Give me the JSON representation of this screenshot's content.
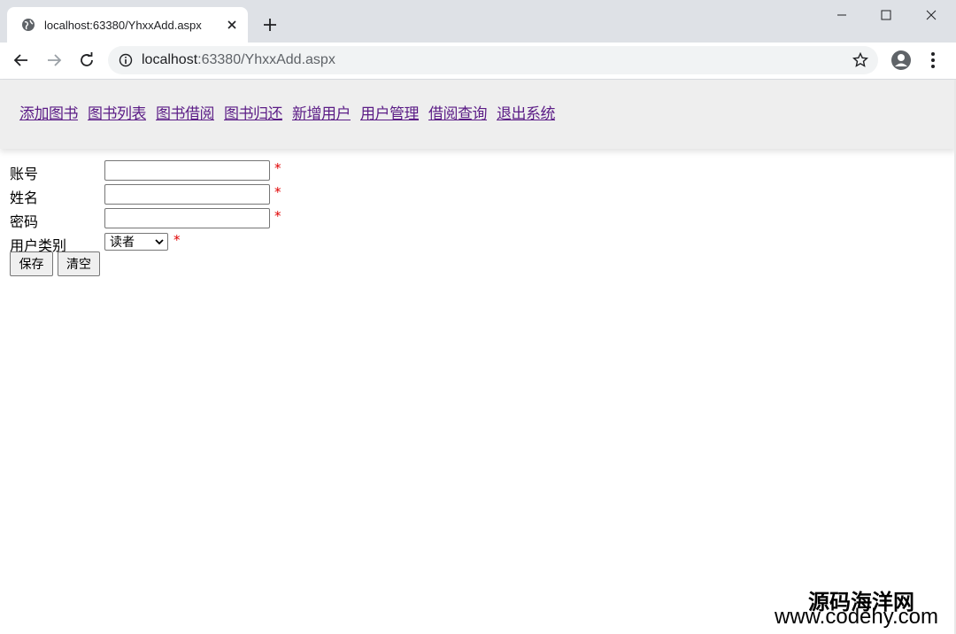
{
  "browser": {
    "tab_title": "localhost:63380/YhxxAdd.aspx",
    "url_host": "localhost",
    "url_rest": ":63380/YhxxAdd.aspx"
  },
  "nav": {
    "links": [
      "添加图书",
      "图书列表",
      "图书借阅",
      "图书归还",
      "新增用户",
      "用户管理",
      "借阅查询",
      "退出系统"
    ]
  },
  "form": {
    "account_label": "账号",
    "name_label": "姓名",
    "password_label": "密码",
    "user_type_label": "用户类别",
    "user_type_value": "读者",
    "required_mark": "*",
    "account_value": "",
    "name_value": "",
    "password_value": ""
  },
  "buttons": {
    "save": "保存",
    "clear": "清空"
  },
  "watermark": {
    "line1": "源码海洋网",
    "line2": "www.codehy.com"
  },
  "colors": {
    "link": "#5b1c86",
    "required": "#e00000",
    "nav_bg": "#eeeeee",
    "tabstrip_bg": "#dee1e6"
  }
}
